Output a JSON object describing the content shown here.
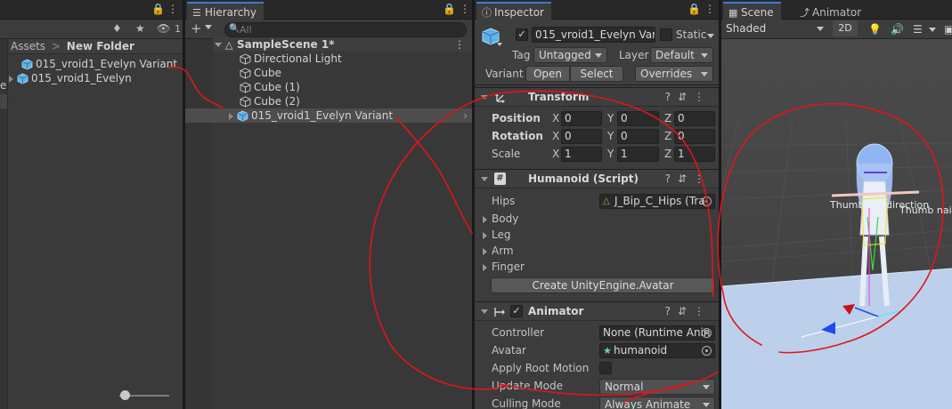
{
  "project": {
    "lock_icon": "lock-icon",
    "breadcrumb": {
      "root": "Assets",
      "separator": ">",
      "current": "New Folder"
    },
    "left_fragment": "e",
    "hidden_count": "1",
    "assets": [
      {
        "label": "015_vroid1_Evelyn Variant",
        "icon": "prefab-variant-icon"
      },
      {
        "label": "015_vroid1_Evelyn",
        "icon": "prefab-model-icon"
      }
    ]
  },
  "hierarchy": {
    "tab_label": "Hierarchy",
    "add_label": "+",
    "search_placeholder": "All",
    "scene_name": "SampleScene 1*",
    "items": [
      {
        "label": "Directional Light"
      },
      {
        "label": "Cube"
      },
      {
        "label": "Cube (1)"
      },
      {
        "label": "Cube (2)"
      },
      {
        "label": "015_vroid1_Evelyn Variant"
      }
    ]
  },
  "inspector": {
    "tab_label": "Inspector",
    "object_name": "015_vroid1_Evelyn Var",
    "static_label": "Static",
    "tag_label": "Tag",
    "tag_value": "Untagged",
    "layer_label": "Layer",
    "layer_value": "Default",
    "variant_label": "Variant",
    "open_label": "Open",
    "select_label": "Select",
    "overrides_label": "Overrides",
    "transform": {
      "title": "Transform",
      "rows": [
        {
          "label": "Position",
          "x": "0",
          "y": "0",
          "z": "0"
        },
        {
          "label": "Rotation",
          "x": "0",
          "y": "0",
          "z": "0"
        },
        {
          "label": "Scale",
          "x": "1",
          "y": "1",
          "z": "1"
        }
      ],
      "axis_x": "X",
      "axis_y": "Y",
      "axis_z": "Z"
    },
    "humanoid": {
      "title": "Humanoid (Script)",
      "hips_label": "Hips",
      "hips_value": "J_Bip_C_Hips (Tra",
      "groups": [
        "Body",
        "Leg",
        "Arm",
        "Finger"
      ],
      "button_label": "Create UnityEngine.Avatar"
    },
    "animator": {
      "title": "Animator",
      "controller_label": "Controller",
      "controller_value": "None (Runtime Anin",
      "avatar_label": "Avatar",
      "avatar_value": "humanoid",
      "root_motion_label": "Apply Root Motion",
      "update_mode_label": "Update Mode",
      "update_mode_value": "Normal",
      "culling_mode_label": "Culling Mode",
      "culling_mode_value": "Always Animate"
    }
  },
  "scene": {
    "scene_tab": "Scene",
    "animator_tab": "Animator",
    "shading_mode": "Shaded",
    "toggle_2d": "2D",
    "overlay_text_1": "Thumb",
    "overlay_text_2": "direction",
    "overlay_text_3": "Thumb nai"
  },
  "colors": {
    "accent_tab": "#3a7bd5",
    "annotation_red": "#e0151b",
    "panel_bg": "#383838",
    "inspector_bg": "#3c3c3c"
  }
}
